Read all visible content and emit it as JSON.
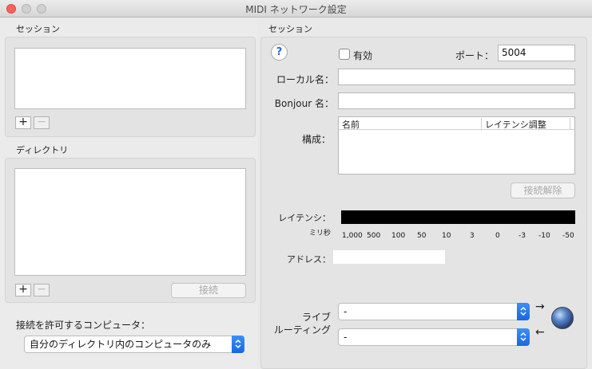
{
  "window": {
    "title": "MIDI ネットワーク設定"
  },
  "left": {
    "sessions_title": "セッション",
    "directory_title": "ディレクトリ",
    "add_label": "+",
    "remove_label": "−",
    "connect_button": "接続",
    "allow_label": "接続を許可するコンピュータ：",
    "allow_select_value": "自分のディレクトリ内のコンピュータのみ"
  },
  "right": {
    "session_title": "セッション",
    "help_label": "?",
    "enabled_label": "有効",
    "enabled_checked": false,
    "port_label": "ポート：",
    "port_value": "5004",
    "local_name_label": "ローカル名：",
    "local_name_value": "",
    "bonjour_label": "Bonjour 名：",
    "bonjour_value": "",
    "config_label": "構成：",
    "columns": [
      "名前",
      "レイテンシ調整"
    ],
    "disconnect_button": "接続解除",
    "latency_label": "レイテンシ：",
    "latency_unit": "ミリ秒",
    "latency_ticks": [
      "1,000",
      "500",
      "100",
      "50",
      "10",
      "3",
      "0",
      "-3",
      "-10",
      "-50"
    ],
    "address_label": "アドレス：",
    "address_value": "",
    "live_routing_label_1": "ライブ",
    "live_routing_label_2": "ルーティング",
    "routing_in_value": "-",
    "routing_out_value": "-",
    "arrow_out": "→",
    "arrow_in": "←"
  }
}
